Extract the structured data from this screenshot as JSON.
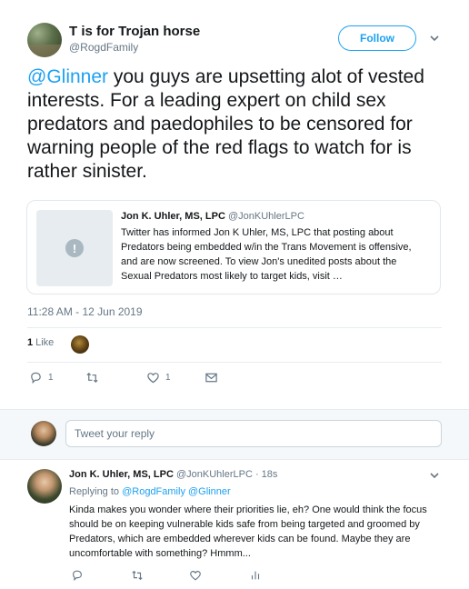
{
  "tweet": {
    "author_name": "T is for Trojan horse",
    "author_handle": "@RogdFamily",
    "follow_label": "Follow",
    "text_mention": "@Glinner",
    "text_body": " you guys are upsetting alot of vested interests.  For a leading expert on child sex predators and paedophiles to be censored for warning people of the red flags to watch for is rather sinister.",
    "card": {
      "author_name": "Jon K. Uhler, MS, LPC",
      "author_handle": "@JonKUhlerLPC",
      "body": "Twitter has informed Jon K Uhler, MS, LPC that posting about Predators being embedded w/in the Trans Movement is offensive, and are now screened. To view Jon's unedited posts about the Sexual Predators most likely to target kids, visit …",
      "thumb_icon": "!"
    },
    "timestamp": "11:28 AM - 12 Jun 2019",
    "likes_count": "1",
    "likes_label": "Like",
    "actions": {
      "reply_count": "1",
      "retweet_count": "",
      "like_count": "1"
    }
  },
  "reply_box": {
    "placeholder": "Tweet your reply"
  },
  "reply": {
    "author_name": "Jon K. Uhler, MS, LPC",
    "author_handle": "@JonKUhlerLPC · 18s",
    "replying_prefix": "Replying to ",
    "replying_to": "@RogdFamily @Glinner",
    "text": "Kinda makes you wonder where their priorities lie, eh? One would think the focus should be on keeping vulnerable kids safe from being targeted and groomed by Predators, which are embedded wherever kids can be found. Maybe they are uncomfortable with something? Hmmm..."
  },
  "colors": {
    "accent": "#1da1f2",
    "secondary_text": "#657786",
    "primary_text": "#14171a"
  },
  "icons": [
    "reply-icon",
    "retweet-icon",
    "heart-icon",
    "message-icon",
    "chevron-down-icon",
    "analytics-icon",
    "alert-icon"
  ]
}
